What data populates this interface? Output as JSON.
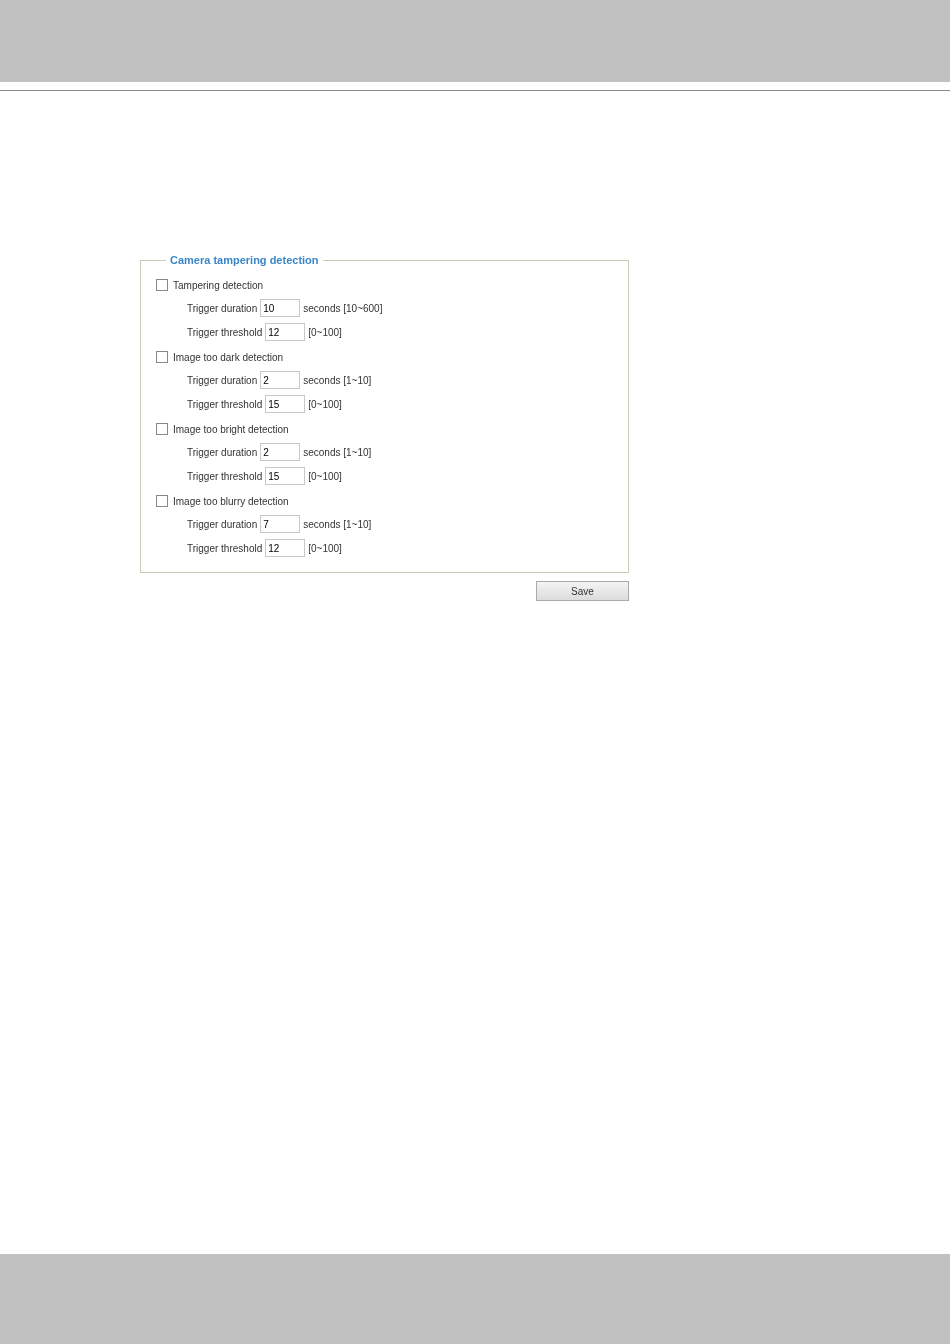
{
  "fieldset": {
    "legend": "Camera tampering detection",
    "groups": [
      {
        "label": "Tampering detection",
        "checked": false,
        "fields": [
          {
            "label": "Trigger duration",
            "value": "10",
            "hint": "seconds [10~600]"
          },
          {
            "label": "Trigger threshold",
            "value": "12",
            "hint": "[0~100]"
          }
        ]
      },
      {
        "label": "Image too dark detection",
        "checked": false,
        "fields": [
          {
            "label": "Trigger duration",
            "value": "2",
            "hint": "seconds [1~10]"
          },
          {
            "label": "Trigger threshold",
            "value": "15",
            "hint": "[0~100]"
          }
        ]
      },
      {
        "label": "Image too bright detection",
        "checked": false,
        "fields": [
          {
            "label": "Trigger duration",
            "value": "2",
            "hint": "seconds [1~10]"
          },
          {
            "label": "Trigger threshold",
            "value": "15",
            "hint": "[0~100]"
          }
        ]
      },
      {
        "label": "Image too blurry detection",
        "checked": false,
        "fields": [
          {
            "label": "Trigger duration",
            "value": "7",
            "hint": "seconds [1~10]"
          },
          {
            "label": "Trigger threshold",
            "value": "12",
            "hint": "[0~100]"
          }
        ]
      }
    ]
  },
  "save_button": "Save"
}
